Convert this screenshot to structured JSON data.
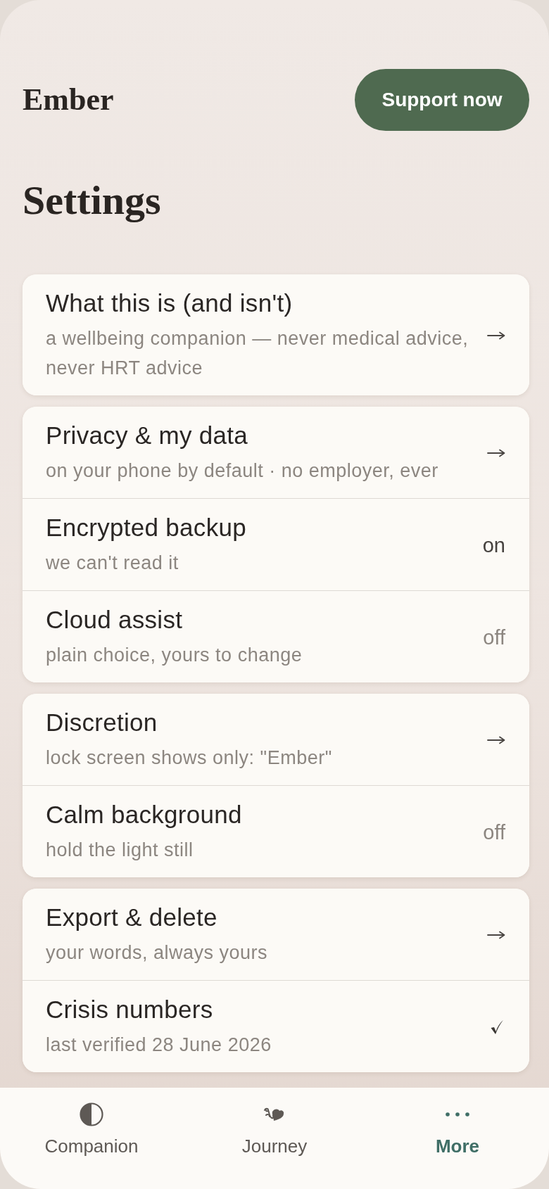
{
  "header": {
    "brand": "Ember",
    "support_button": "Support now"
  },
  "page_title": "Settings",
  "groups": [
    {
      "items": [
        {
          "kind": "link",
          "title": "What this is (and isn't)",
          "subtitle": "a wellbeing companion — never medical advice, never HRT advice"
        }
      ]
    },
    {
      "items": [
        {
          "kind": "link",
          "title": "Privacy & my data",
          "subtitle": "on your phone by default · no employer, ever"
        },
        {
          "kind": "toggle",
          "title": "Encrypted backup",
          "subtitle": "we can't read it",
          "status": "on",
          "on": true
        },
        {
          "kind": "toggle",
          "title": "Cloud assist",
          "subtitle": "plain choice, yours to change",
          "status": "off",
          "on": false
        }
      ]
    },
    {
      "items": [
        {
          "kind": "link",
          "title": "Discretion",
          "subtitle": "lock screen shows only: \"Ember\""
        },
        {
          "kind": "toggle",
          "title": "Calm background",
          "subtitle": "hold the light still",
          "status": "off",
          "on": false
        }
      ]
    },
    {
      "items": [
        {
          "kind": "link",
          "title": "Export & delete",
          "subtitle": "your words, always yours"
        },
        {
          "kind": "check",
          "title": "Crisis numbers",
          "subtitle": "last verified 28 June 2026"
        }
      ]
    }
  ],
  "nav": [
    {
      "kind": "companion",
      "label": "Companion",
      "selected": false
    },
    {
      "kind": "journey",
      "label": "Journey",
      "selected": false
    },
    {
      "kind": "more",
      "label": "More",
      "selected": true
    }
  ]
}
